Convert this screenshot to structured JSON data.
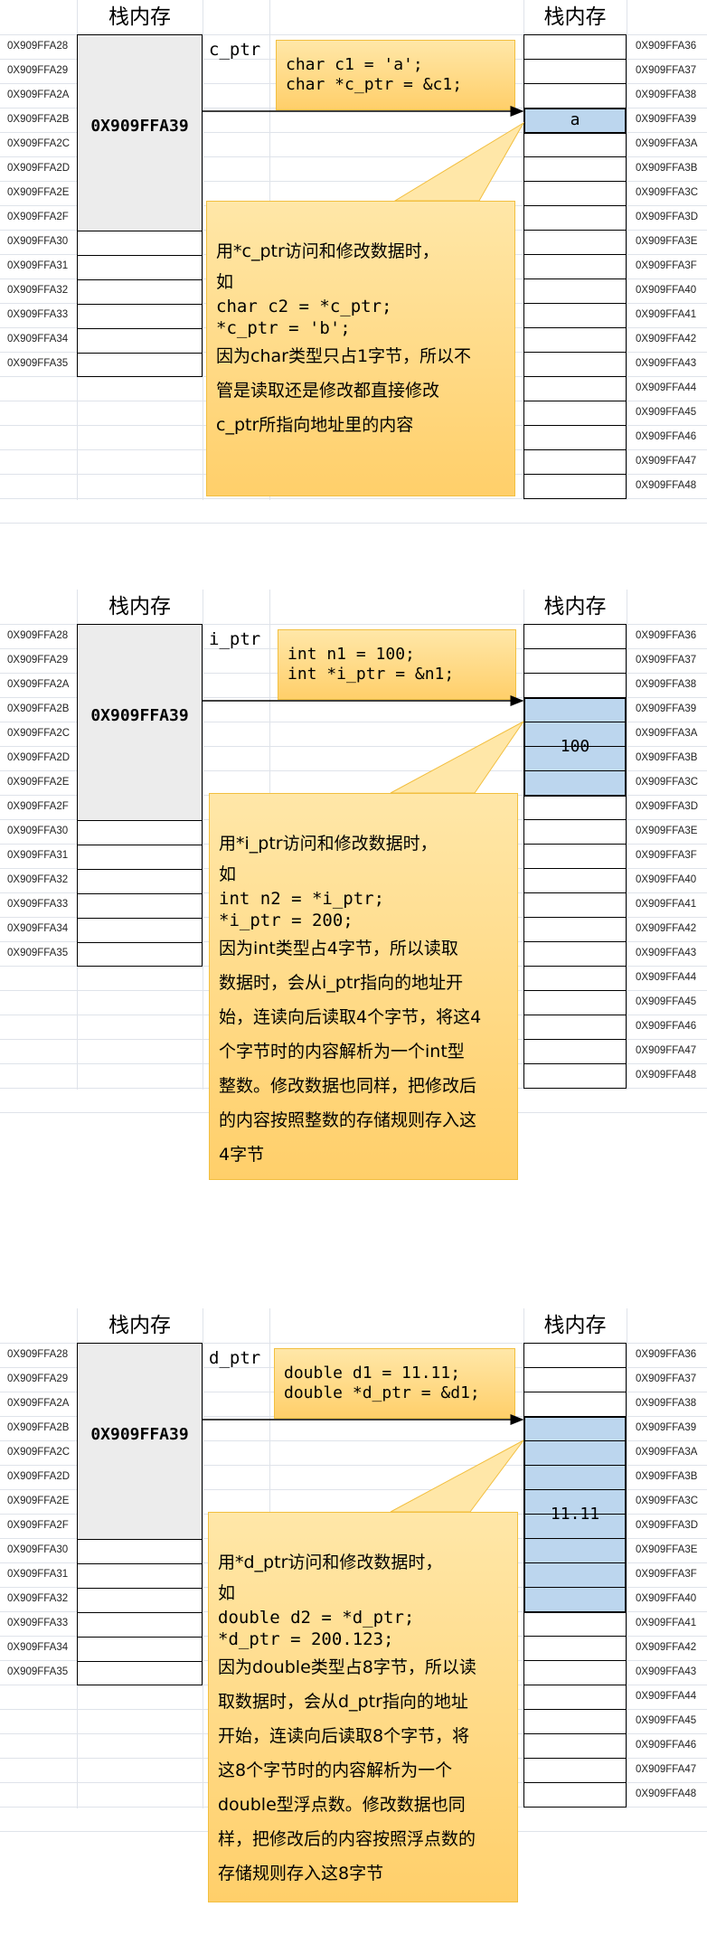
{
  "left_addresses": [
    "0X909FFA28",
    "0X909FFA29",
    "0X909FFA2A",
    "0X909FFA2B",
    "0X909FFA2C",
    "0X909FFA2D",
    "0X909FFA2E",
    "0X909FFA2F",
    "0X909FFA30",
    "0X909FFA31",
    "0X909FFA32",
    "0X909FFA33",
    "0X909FFA34",
    "0X909FFA35"
  ],
  "right_addresses": [
    "0X909FFA36",
    "0X909FFA37",
    "0X909FFA38",
    "0X909FFA39",
    "0X909FFA3A",
    "0X909FFA3B",
    "0X909FFA3C",
    "0X909FFA3D",
    "0X909FFA3E",
    "0X909FFA3F",
    "0X909FFA40",
    "0X909FFA41",
    "0X909FFA42",
    "0X909FFA43",
    "0X909FFA44",
    "0X909FFA45",
    "0X909FFA46",
    "0X909FFA47",
    "0X909FFA48"
  ],
  "panels": [
    {
      "left_header": "栈内存",
      "right_header": "栈内存",
      "pointer_name": "c_ptr",
      "pointer_value": "0X909FFA39",
      "declaration": [
        "char c1 = 'a';",
        "char *c_ptr = &c1;"
      ],
      "stored_value": "a",
      "highlight_bytes": 1,
      "explanation": {
        "line1": "用*c_ptr访问和修改数据时，",
        "line2": "如",
        "code": [
          "char c2 = *c_ptr;",
          "*c_ptr = 'b';"
        ],
        "lines": [
          "因为char类型只占1字节，所以不",
          "管是读取还是修改都直接修改",
          "c_ptr所指向地址里的内容"
        ]
      }
    },
    {
      "left_header": "栈内存",
      "right_header": "栈内存",
      "pointer_name": "i_ptr",
      "pointer_value": "0X909FFA39",
      "declaration": [
        "int n1 = 100;",
        "int *i_ptr = &n1;"
      ],
      "stored_value": "100",
      "highlight_bytes": 4,
      "explanation": {
        "line1": "用*i_ptr访问和修改数据时，",
        "line2": "如",
        "code": [
          "int n2 = *i_ptr;",
          "*i_ptr = 200;"
        ],
        "lines": [
          "因为int类型占4字节，所以读取",
          "数据时，会从i_ptr指向的地址开",
          "始，连读向后读取4个字节，将这4",
          "个字节时的内容解析为一个int型",
          "整数。修改数据也同样，把修改后",
          "的内容按照整数的存储规则存入这",
          "4字节"
        ]
      }
    },
    {
      "left_header": "栈内存",
      "right_header": "栈内存",
      "pointer_name": "d_ptr",
      "pointer_value": "0X909FFA39",
      "declaration": [
        "double d1 = 11.11;",
        "double *d_ptr = &d1;"
      ],
      "stored_value": "11.11",
      "highlight_bytes": 8,
      "explanation": {
        "line1": "用*d_ptr访问和修改数据时，",
        "line2": "如",
        "code": [
          "double d2 = *d_ptr;",
          "*d_ptr = 200.123;"
        ],
        "lines": [
          "因为double类型占8字节，所以读",
          "取数据时，会从d_ptr指向的地址",
          "开始，连读向后读取8个字节，将",
          "这8个字节时的内容解析为一个",
          "double型浮点数。修改数据也同",
          "样，把修改后的内容按照浮点数的",
          "存储规则存入这8字节"
        ]
      }
    }
  ]
}
